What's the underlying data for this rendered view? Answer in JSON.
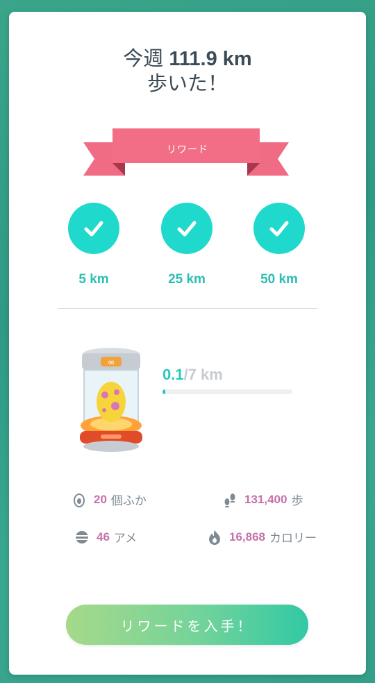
{
  "header": {
    "line1_prefix": "今週",
    "distance": "111.9 km",
    "line2": "歩いた！"
  },
  "ribbon": {
    "label": "リワード"
  },
  "milestones": [
    {
      "label": "5 km",
      "completed": true
    },
    {
      "label": "25 km",
      "completed": true
    },
    {
      "label": "50 km",
      "completed": true
    }
  ],
  "egg_progress": {
    "current": "0.1",
    "total": "/7 km",
    "fraction": 0.014
  },
  "stats": {
    "hatched": {
      "value": "20",
      "label": "個ふか"
    },
    "steps": {
      "value": "131,400",
      "label": "歩"
    },
    "candy": {
      "value": "46",
      "label": "アメ"
    },
    "calories": {
      "value": "16,868",
      "label": "カロリー"
    }
  },
  "button": {
    "label": "リワードを入手！"
  },
  "colors": {
    "accent": "#1fd9cc",
    "ribbon": "#f06b84",
    "stat_value": "#c670a8"
  }
}
